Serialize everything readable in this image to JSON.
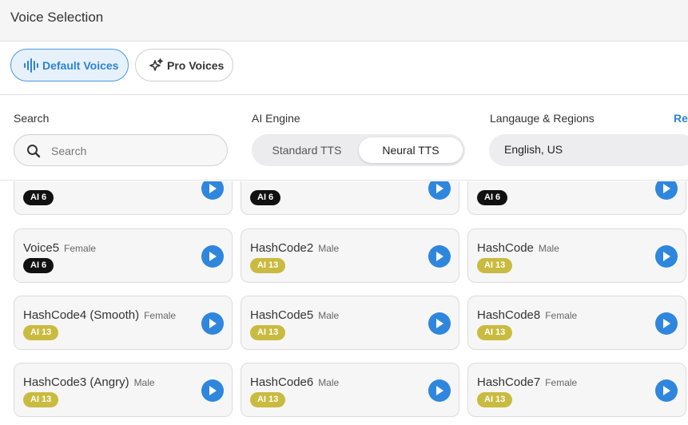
{
  "header": {
    "title": "Voice Selection"
  },
  "tabs": [
    {
      "label": "Default Voices",
      "icon": "sound-wave-icon",
      "active": true
    },
    {
      "label": "Pro Voices",
      "icon": "sparkle-icon",
      "active": false
    }
  ],
  "filters": {
    "search_label": "Search",
    "search_placeholder": "Search",
    "engine_label": "AI Engine",
    "engine_options": [
      "Standard TTS",
      "Neural TTS"
    ],
    "engine_selected": "Neural TTS",
    "language_label": "Langauge & Regions",
    "language_value": "English, US",
    "reset_label": "Re"
  },
  "colors": {
    "accent": "#2d82d6",
    "badge_black": "#111111",
    "badge_olive": "#c9bb3f"
  },
  "voices": [
    {
      "name": "",
      "gender": "",
      "badge": "AI 6"
    },
    {
      "name": "",
      "gender": "",
      "badge": "AI 6"
    },
    {
      "name": "",
      "gender": "",
      "badge": "AI 6"
    },
    {
      "name": "Voice5",
      "gender": "Female",
      "badge": "AI 6"
    },
    {
      "name": "HashCode2",
      "gender": "Male",
      "badge": "AI 13"
    },
    {
      "name": "HashCode",
      "gender": "Male",
      "badge": "AI 13"
    },
    {
      "name": "HashCode4 (Smooth)",
      "gender": "Female",
      "badge": "AI 13"
    },
    {
      "name": "HashCode5",
      "gender": "Male",
      "badge": "AI 13"
    },
    {
      "name": "HashCode8",
      "gender": "Female",
      "badge": "AI 13"
    },
    {
      "name": "HashCode3 (Angry)",
      "gender": "Male",
      "badge": "AI 13"
    },
    {
      "name": "HashCode6",
      "gender": "Male",
      "badge": "AI 13"
    },
    {
      "name": "HashCode7",
      "gender": "Female",
      "badge": "AI 13"
    }
  ]
}
